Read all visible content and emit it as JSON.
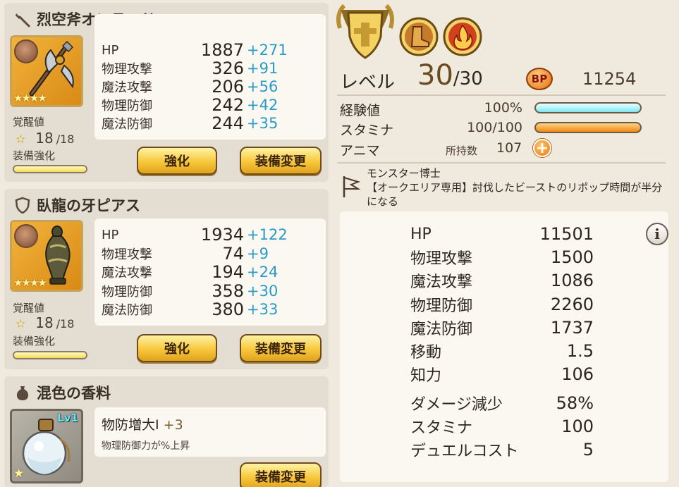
{
  "equipment": [
    {
      "name": "烈空斧オンラード",
      "stats": [
        {
          "label": "HP",
          "value": "1887",
          "bonus": "+271"
        },
        {
          "label": "物理攻撃",
          "value": "326",
          "bonus": "+91"
        },
        {
          "label": "魔法攻撃",
          "value": "206",
          "bonus": "+56"
        },
        {
          "label": "物理防御",
          "value": "242",
          "bonus": "+42"
        },
        {
          "label": "魔法防御",
          "value": "244",
          "bonus": "+35"
        }
      ],
      "awaken_label": "覚醒値",
      "awaken_current": "18",
      "awaken_max": "/18",
      "enhance_label": "装備強化",
      "enhance_fraction": 1.0,
      "enhance_button": "強化",
      "change_button": "装備変更",
      "stars": "★★★★"
    },
    {
      "name": "臥龍の牙ピアス",
      "stats": [
        {
          "label": "HP",
          "value": "1934",
          "bonus": "+122"
        },
        {
          "label": "物理攻撃",
          "value": "74",
          "bonus": "+9"
        },
        {
          "label": "魔法攻撃",
          "value": "194",
          "bonus": "+24"
        },
        {
          "label": "物理防御",
          "value": "358",
          "bonus": "+30"
        },
        {
          "label": "魔法防御",
          "value": "380",
          "bonus": "+33"
        }
      ],
      "awaken_label": "覚醒値",
      "awaken_current": "18",
      "awaken_max": "/18",
      "enhance_label": "装備強化",
      "enhance_fraction": 1.0,
      "enhance_button": "強化",
      "change_button": "装備変更",
      "stars": "★★★★"
    }
  ],
  "spice": {
    "name": "混色の香料",
    "level_badge": "Lv1",
    "effect_name": "物防増大Ⅰ",
    "effect_bonus": "+3",
    "effect_desc": "物理防御力が%上昇",
    "change_button": "装備変更",
    "stars": "★"
  },
  "status": {
    "level_label": "レベル",
    "level_current": "30",
    "level_max": "/30",
    "bp_badge": "BP",
    "bp_value": "11254",
    "exp_label": "経験値",
    "exp_value": "100%",
    "exp_fraction": 1.0,
    "stamina_label": "スタミナ",
    "stamina_value": "100/100",
    "stamina_fraction": 1.0,
    "anima_label": "アニマ",
    "owned_label": "所持数",
    "owned_value": "107",
    "plus_symbol": "+"
  },
  "skill": {
    "title": "モンスター博士",
    "description": "【オークエリア専用】討伐したビーストのリポップ時間が半分になる"
  },
  "totals": [
    {
      "label": "HP",
      "value": "11501"
    },
    {
      "label": "物理攻撃",
      "value": "1500"
    },
    {
      "label": "魔法攻撃",
      "value": "1086"
    },
    {
      "label": "物理防御",
      "value": "2260"
    },
    {
      "label": "魔法防御",
      "value": "1737"
    },
    {
      "label": "移動",
      "value": "1.5"
    },
    {
      "label": "知力",
      "value": "106"
    },
    {
      "label": "ダメージ減少",
      "value": "58%"
    },
    {
      "label": "スタミナ",
      "value": "100"
    },
    {
      "label": "デュエルコスト",
      "value": "5"
    }
  ],
  "info_symbol": "i",
  "colors": {
    "bonus": "#2a9bc9",
    "button_gold": "#f7c73b",
    "exp_bar": "#7fe6f1",
    "stamina_bar": "#ee8a13"
  }
}
